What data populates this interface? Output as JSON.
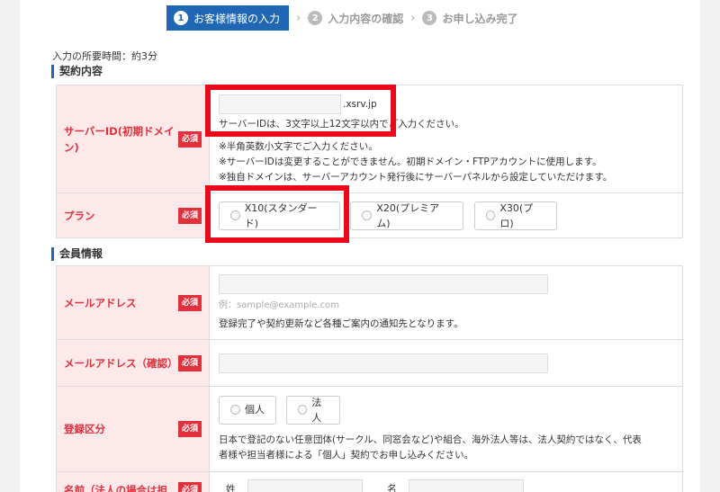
{
  "steps": [
    {
      "num": "1",
      "label": "お客様情報の入力"
    },
    {
      "num": "2",
      "label": "入力内容の確認"
    },
    {
      "num": "3",
      "label": "お申し込み完了"
    }
  ],
  "step_separator": "›",
  "estimated_time": "入力の所要時間：約3分",
  "sections": {
    "contract": "契約内容",
    "member": "会員情報"
  },
  "required_badge": "必須",
  "server_id": {
    "label": "サーバーID(初期ドメイン)",
    "value": "",
    "suffix": ".xsrv.jp",
    "hint": "サーバーIDは、3文字以上12文字以内でご入力ください。",
    "notes": [
      "※半角英数小文字でご入力ください。",
      "※サーバーIDは変更することができません。初期ドメイン・FTPアカウントに使用します。",
      "※独自ドメインは、サーバーアカウント発行後にサーバーパネルから設定していただけます。"
    ]
  },
  "plan": {
    "label": "プラン",
    "options": [
      "X10(スタンダード)",
      "X20(プレミアム)",
      "X30(プロ)"
    ]
  },
  "email": {
    "label": "メールアドレス",
    "value": "",
    "placeholder": "例：sample@example.com",
    "note": "登録完了や契約更新など各種ご案内の通知先となります。"
  },
  "email_confirm": {
    "label": "メールアドレス（確認）",
    "value": ""
  },
  "registration_type": {
    "label": "登録区分",
    "options": [
      "個人",
      "法人"
    ],
    "note": "日本で登記のない任意団体(サークル、同窓会など)や組合、海外法人等は、法人契約ではなく、代表者様や担当者様による「個人」契約でお申し込みください。"
  },
  "name": {
    "label": "名前（法人の場合は担",
    "last_name_label": "姓",
    "first_name_label": "名"
  }
}
